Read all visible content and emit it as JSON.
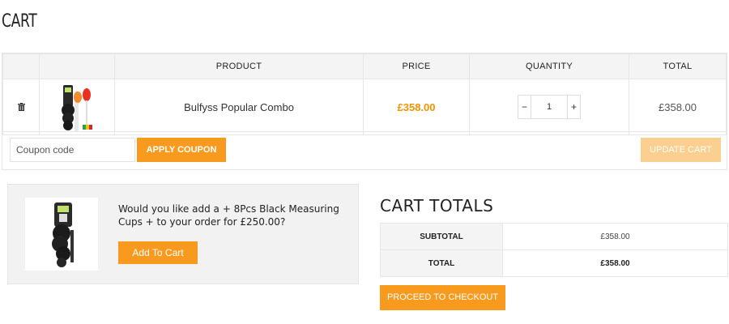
{
  "page": {
    "title": "CART"
  },
  "table": {
    "headers": {
      "product": "PRODUCT",
      "price": "PRICE",
      "quantity": "QUANTITY",
      "total": "TOTAL"
    },
    "rows": [
      {
        "name": "Bulfyss Popular Combo",
        "price": "£358.00",
        "quantity": "1",
        "total": "£358.00"
      }
    ],
    "qty_minus": "−",
    "qty_plus": "+",
    "remove_icon": "trash-icon"
  },
  "coupon": {
    "placeholder": "Coupon code",
    "apply_label": "APPLY COUPON",
    "update_label": "UPDATE CART"
  },
  "upsell": {
    "text": "Would you like add a + 8Pcs Black Measuring Cups + to your order for  £250.00?",
    "button_label": "Add To Cart"
  },
  "totals": {
    "title": "CART TOTALS",
    "subtotal_label": "SUBTOTAL",
    "subtotal_value": "£358.00",
    "total_label": "TOTAL",
    "total_value": "£358.00",
    "checkout_label": "PROCEED TO CHECKOUT"
  },
  "colors": {
    "accent": "#f79a1e",
    "price": "#f39200",
    "update_disabled": "#fbcf8f"
  }
}
